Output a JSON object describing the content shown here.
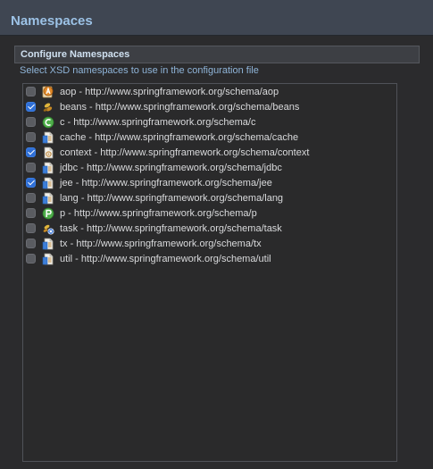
{
  "header": {
    "title": "Namespaces"
  },
  "section": {
    "title": "Configure Namespaces",
    "description": "Select XSD namespaces to use in the configuration file"
  },
  "namespaces": [
    {
      "label": "aop - http://www.springframework.org/schema/aop",
      "checked": false,
      "icon": "aspect-icon"
    },
    {
      "label": "beans - http://www.springframework.org/schema/beans",
      "checked": true,
      "icon": "beans-icon"
    },
    {
      "label": "c - http://www.springframework.org/schema/c",
      "checked": false,
      "icon": "c-namespace-icon"
    },
    {
      "label": "cache - http://www.springframework.org/schema/cache",
      "checked": false,
      "icon": "document-icon"
    },
    {
      "label": "context - http://www.springframework.org/schema/context",
      "checked": true,
      "icon": "context-document-icon"
    },
    {
      "label": "jdbc - http://www.springframework.org/schema/jdbc",
      "checked": false,
      "icon": "document-icon"
    },
    {
      "label": "jee - http://www.springframework.org/schema/jee",
      "checked": true,
      "icon": "document-icon"
    },
    {
      "label": "lang - http://www.springframework.org/schema/lang",
      "checked": false,
      "icon": "document-icon"
    },
    {
      "label": "p - http://www.springframework.org/schema/p",
      "checked": false,
      "icon": "p-namespace-icon"
    },
    {
      "label": "task - http://www.springframework.org/schema/task",
      "checked": false,
      "icon": "task-icon"
    },
    {
      "label": "tx - http://www.springframework.org/schema/tx",
      "checked": false,
      "icon": "document-icon"
    },
    {
      "label": "util - http://www.springframework.org/schema/util",
      "checked": false,
      "icon": "document-icon"
    }
  ],
  "colors": {
    "header_bg": "#3f4652",
    "header_title": "#9cc2e6",
    "checkbox_checked": "#2f6fd6",
    "checkbox_unchecked": "#5a5c61"
  }
}
